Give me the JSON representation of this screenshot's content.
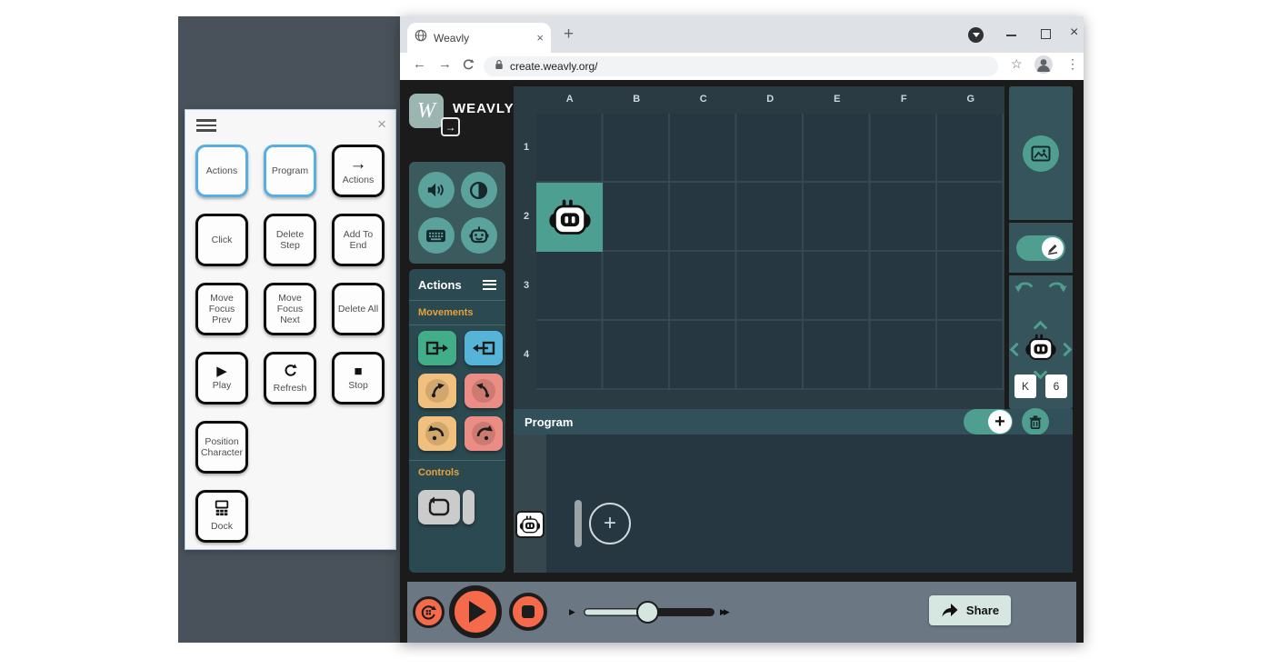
{
  "browser": {
    "tab_title": "Weavly",
    "url": "create.weavly.org/"
  },
  "icons": {
    "close": "×",
    "plus": "+",
    "star": "☆",
    "menu_dots": "⋮",
    "back_arrow": "←",
    "forward_arrow": "→",
    "arrow_right": "→",
    "play": "▶",
    "stop": "■",
    "slider_slow": "▶",
    "slider_fast": "▶▶"
  },
  "overlay": {
    "buttons": [
      {
        "label": "Actions"
      },
      {
        "label": "Program"
      },
      {
        "label": "Actions"
      },
      {
        "label": "Click"
      },
      {
        "label": "Delete Step"
      },
      {
        "label": "Add To End"
      },
      {
        "label": "Move Focus Prev"
      },
      {
        "label": "Move Focus Next"
      },
      {
        "label": "Delete All"
      },
      {
        "label": "Play"
      },
      {
        "label": "Refresh"
      },
      {
        "label": "Stop"
      },
      {
        "label": "Position Character"
      },
      {
        "label": "Dock"
      }
    ]
  },
  "app": {
    "brand": {
      "letter": "W",
      "name": "WEAVLY"
    },
    "actions_panel": {
      "title": "Actions",
      "movements_label": "Movements",
      "controls_label": "Controls"
    },
    "grid": {
      "columns": [
        "A",
        "B",
        "C",
        "D",
        "E",
        "F",
        "G"
      ],
      "rows": [
        "1",
        "2",
        "3",
        "4"
      ],
      "character_cell": "A2"
    },
    "character_position": {
      "column_value": "K",
      "row_value": "6"
    },
    "program": {
      "title": "Program"
    },
    "share": {
      "label": "Share"
    },
    "colors": {
      "teal_accent": "#4f9e90",
      "panel_teal": "#35545b",
      "orange_play": "#f46a4a",
      "movement_forward": "#41ae89",
      "movement_backward": "#56b4d9",
      "movement_turn_left": "#f2c07e",
      "movement_turn_right": "#eb8d84",
      "section_label": "#e7a23b",
      "highlight_cell": "#4d9f91"
    }
  }
}
